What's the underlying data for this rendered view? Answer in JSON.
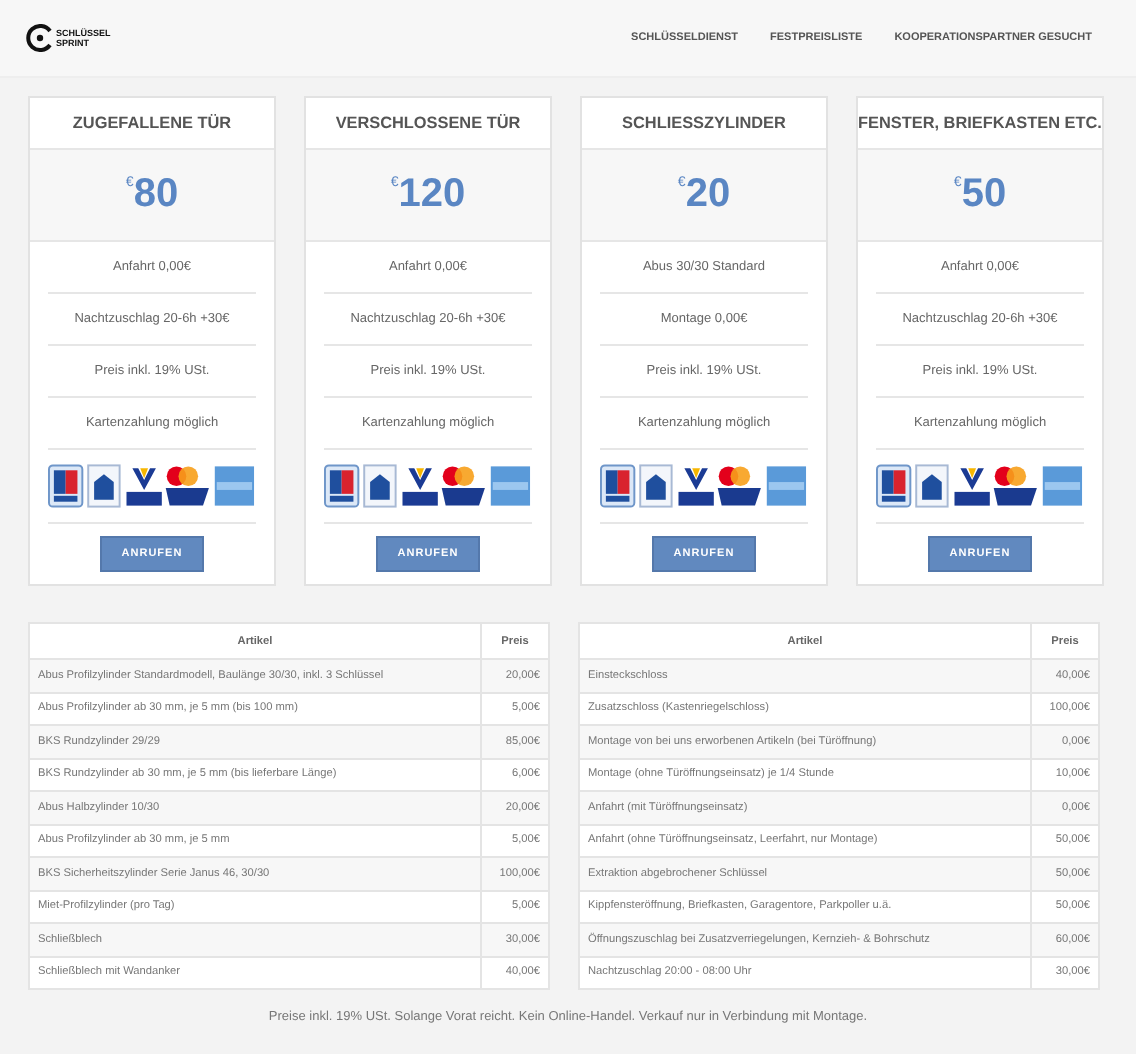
{
  "header": {
    "logo": [
      "SCHLÜSSEL",
      "SPRINT"
    ],
    "nav": [
      "SCHLÜSSELDIENST",
      "FESTPREISLISTE",
      "KOOPERATIONSPARTNER GESUCHT"
    ]
  },
  "plans": [
    {
      "title": "ZUGEFALLENE TÜR",
      "currency": "€",
      "price": "80",
      "features": [
        "Anfahrt 0,00€",
        "Nachtzuschlag 20-6h +30€",
        "Preis inkl. 19% USt.",
        "Kartenzahlung möglich"
      ],
      "button": "ANRUFEN"
    },
    {
      "title": "VERSCHLOSSENE TÜR",
      "currency": "€",
      "price": "120",
      "features": [
        "Anfahrt 0,00€",
        "Nachtzuschlag 20-6h +30€",
        "Preis inkl. 19% USt.",
        "Kartenzahlung möglich"
      ],
      "button": "ANRUFEN"
    },
    {
      "title": "SCHLIESSZYLINDER",
      "currency": "€",
      "price": "20",
      "features": [
        "Abus 30/30 Standard",
        "Montage 0,00€",
        "Preis inkl. 19% USt.",
        "Kartenzahlung möglich"
      ],
      "button": "ANRUFEN"
    },
    {
      "title": "FENSTER, BRIEFKASTEN ETC.",
      "currency": "€",
      "price": "50",
      "features": [
        "Anfahrt 0,00€",
        "Nachtzuschlag 20-6h +30€",
        "Preis inkl. 19% USt.",
        "Kartenzahlung möglich"
      ],
      "button": "ANRUFEN"
    }
  ],
  "tables": [
    {
      "columns": [
        "Artikel",
        "Preis"
      ],
      "rows": [
        [
          "Abus Profilzylinder Standardmodell, Baulänge 30/30, inkl. 3 Schlüssel",
          "20,00€"
        ],
        [
          "Abus Profilzylinder ab 30 mm, je 5 mm (bis 100 mm)",
          "5,00€"
        ],
        [
          "BKS Rundzylinder 29/29",
          "85,00€"
        ],
        [
          "BKS Rundzylinder ab 30 mm, je 5 mm (bis lieferbare Länge)",
          "6,00€"
        ],
        [
          "Abus Halbzylinder 10/30",
          "20,00€"
        ],
        [
          "Abus Profilzylinder ab 30 mm, je 5 mm",
          "5,00€"
        ],
        [
          "BKS Sicherheitszylinder Serie Janus 46, 30/30",
          "100,00€"
        ],
        [
          "Miet-Profilzylinder (pro Tag)",
          "5,00€"
        ],
        [
          "Schließblech",
          "30,00€"
        ],
        [
          "Schließblech mit Wandanker",
          "40,00€"
        ]
      ]
    },
    {
      "columns": [
        "Artikel",
        "Preis"
      ],
      "rows": [
        [
          "Einsteckschloss",
          "40,00€"
        ],
        [
          "Zusatzschloss (Kastenriegelschloss)",
          "100,00€"
        ],
        [
          "Montage von bei uns erworbenen Artikeln (bei Türöffnung)",
          "0,00€"
        ],
        [
          "Montage (ohne Türöffnungseinsatz) je 1/4 Stunde",
          "10,00€"
        ],
        [
          "Anfahrt (mit Türöffnungseinsatz)",
          "0,00€"
        ],
        [
          "Anfahrt (ohne Türöffnungseinsatz, Leerfahrt, nur Montage)",
          "50,00€"
        ],
        [
          "Extraktion abgebrochener Schlüssel",
          "50,00€"
        ],
        [
          "Kippfensteröffnung, Briefkasten, Garagentore, Parkpoller u.ä.",
          "50,00€"
        ],
        [
          "Öffnungszuschlag bei Zusatzverriegelungen, Kernzieh- & Bohrschutz",
          "60,00€"
        ],
        [
          "Nachtzuschlag 20:00 - 08:00 Uhr",
          "30,00€"
        ]
      ]
    }
  ],
  "footer_note": "Preise inkl. 19% USt. Solange Vorat reicht. Kein Online-Handel. Verkauf nur in Verbindung mit Montage."
}
